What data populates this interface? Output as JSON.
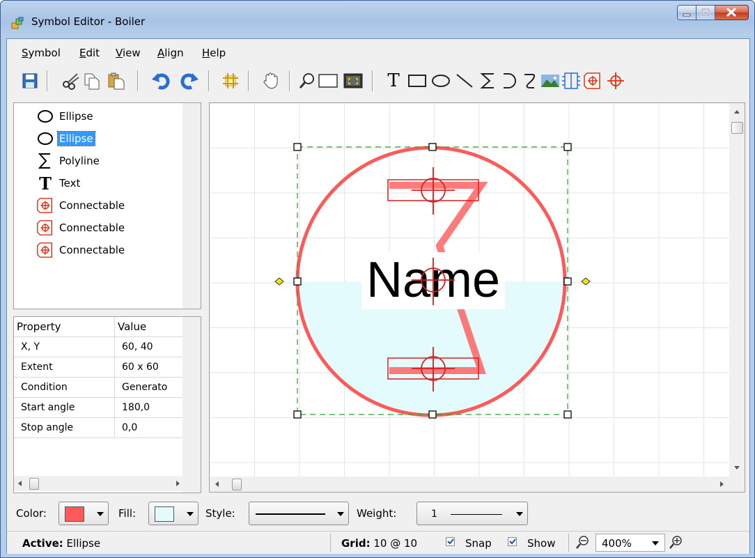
{
  "window": {
    "title": "Symbol Editor - Boiler"
  },
  "menu": [
    {
      "key": "S",
      "rest": "ymbol"
    },
    {
      "key": "E",
      "rest": "dit"
    },
    {
      "key": "V",
      "rest": "iew"
    },
    {
      "key": "A",
      "rest": "lign"
    },
    {
      "key": "H",
      "rest": "elp"
    }
  ],
  "toolbar": {
    "icons": [
      "save-icon",
      "cut-icon",
      "copy-icon",
      "paste-icon",
      "undo-icon",
      "redo-icon",
      "grid-icon",
      "pan-icon",
      "zoom-icon",
      "rectangle-select-icon",
      "fit-icon",
      "text-tool-icon",
      "rectangle-tool-icon",
      "ellipse-tool-icon",
      "line-tool-icon",
      "polyline-tool-icon",
      "arc-tool-icon",
      "curve-tool-icon",
      "image-tool-icon",
      "symbol-tool-icon",
      "connectable-tool-icon",
      "connection-point-icon"
    ],
    "text_tool_glyph": "T"
  },
  "tree": {
    "items": [
      {
        "label": "Ellipse",
        "icon": "ellipse-icon",
        "selected": false
      },
      {
        "label": "Ellipse",
        "icon": "ellipse-icon",
        "selected": true
      },
      {
        "label": "Polyline",
        "icon": "polyline-icon",
        "selected": false
      },
      {
        "label": "Text",
        "icon": "text-icon",
        "selected": false
      },
      {
        "label": "Connectable",
        "icon": "connectable-icon",
        "selected": false
      },
      {
        "label": "Connectable",
        "icon": "connectable-icon",
        "selected": false
      },
      {
        "label": "Connectable",
        "icon": "connectable-icon",
        "selected": false
      }
    ]
  },
  "properties": {
    "header": {
      "property": "Property",
      "value": "Value"
    },
    "rows": [
      {
        "property": "X, Y",
        "value": "60, 40"
      },
      {
        "property": "Extent",
        "value": "60 x 60"
      },
      {
        "property": "Condition",
        "value": "Generato"
      },
      {
        "property": "Start angle",
        "value": "180,0"
      },
      {
        "property": "Stop angle",
        "value": "0,0"
      }
    ]
  },
  "canvas": {
    "symbol_text": "Name",
    "colors": {
      "stroke": "#ff5a5a",
      "fill": "#e3fbfd",
      "selection": "#27a327",
      "handle": "#000000",
      "pivot": "#f2e600"
    }
  },
  "style_bar": {
    "color_label": "Color:",
    "fill_label": "Fill:",
    "style_label": "Style:",
    "weight_label": "Weight:",
    "weight_value": "1",
    "color_value": "#ff5a5a",
    "fill_value": "#e3fbfd"
  },
  "status": {
    "active_label": "Active:",
    "active_value": "Ellipse",
    "grid_label": "Grid:",
    "grid_value": "10 @ 10",
    "snap_label": "Snap",
    "snap_checked": true,
    "show_label": "Show",
    "show_checked": true,
    "zoom_value": "400%"
  }
}
